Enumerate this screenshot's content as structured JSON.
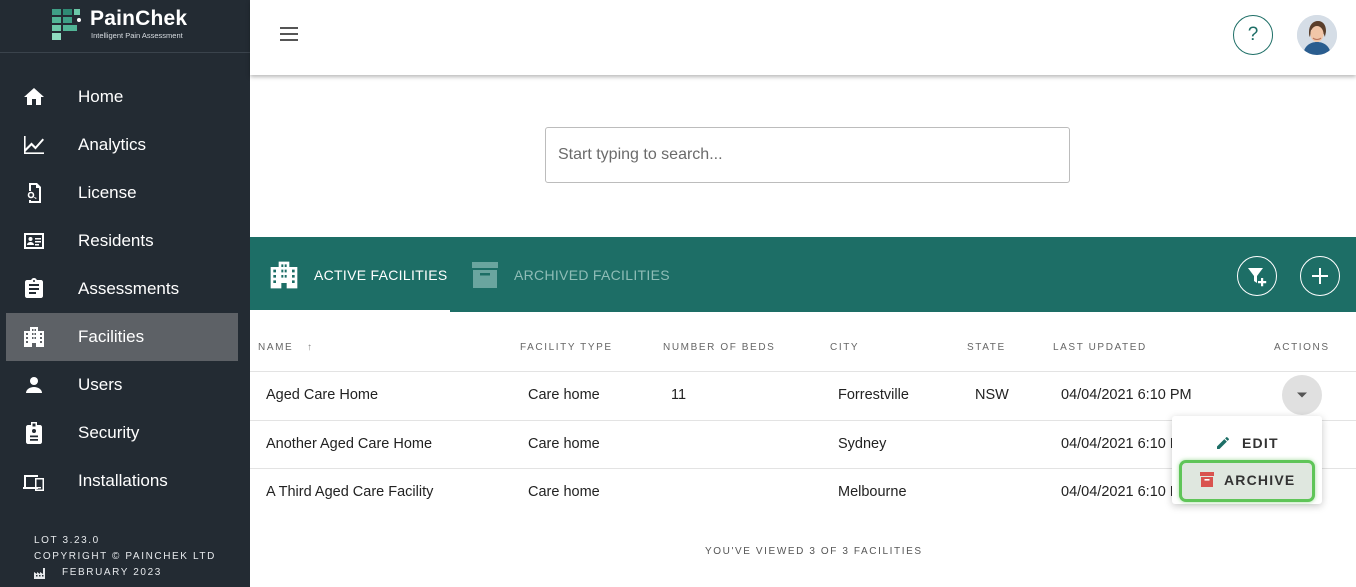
{
  "brand": {
    "name": "PainChek",
    "tagline": "Intelligent Pain Assessment"
  },
  "sidebar": {
    "items": [
      {
        "label": "Home",
        "icon": "home-icon"
      },
      {
        "label": "Analytics",
        "icon": "analytics-icon"
      },
      {
        "label": "License",
        "icon": "license-icon"
      },
      {
        "label": "Residents",
        "icon": "residents-icon"
      },
      {
        "label": "Assessments",
        "icon": "assessments-icon"
      },
      {
        "label": "Facilities",
        "icon": "facilities-icon",
        "active": true
      },
      {
        "label": "Users",
        "icon": "users-icon"
      },
      {
        "label": "Security",
        "icon": "security-icon"
      },
      {
        "label": "Installations",
        "icon": "installations-icon"
      }
    ],
    "footer": {
      "lot": "LOT 3.23.0",
      "copyright": "COPYRIGHT © PAINCHEK LTD",
      "date": "FEBRUARY 2023"
    }
  },
  "header": {
    "help_label": "?"
  },
  "search": {
    "placeholder": "Start typing to search..."
  },
  "tabs": {
    "active": "ACTIVE FACILITIES",
    "archived": "ARCHIVED FACILITIES"
  },
  "table": {
    "columns": [
      "NAME",
      "FACILITY TYPE",
      "NUMBER OF BEDS",
      "CITY",
      "STATE",
      "LAST UPDATED",
      "ACTIONS"
    ],
    "sort_indicator": "↑",
    "rows": [
      {
        "name": "Aged Care Home",
        "type": "Care home",
        "beds": "11",
        "city": "Forrestville",
        "state": "NSW",
        "updated": "04/04/2021 6:10 PM"
      },
      {
        "name": "Another Aged Care Home",
        "type": "Care home",
        "beds": "",
        "city": "Sydney",
        "state": "",
        "updated": "04/04/2021 6:10 PM"
      },
      {
        "name": "A Third Aged Care Facility",
        "type": "Care home",
        "beds": "",
        "city": "Melbourne",
        "state": "",
        "updated": "04/04/2021 6:10 PM"
      }
    ]
  },
  "actions_menu": {
    "edit": "EDIT",
    "archive": "ARCHIVE"
  },
  "viewed_text": "YOU'VE VIEWED 3 OF 3 FACILITIES",
  "colors": {
    "sidebar_bg": "#232b33",
    "accent_teal": "#1d6e66",
    "highlight_green": "#5fc558",
    "archive_icon": "#d9534f"
  }
}
